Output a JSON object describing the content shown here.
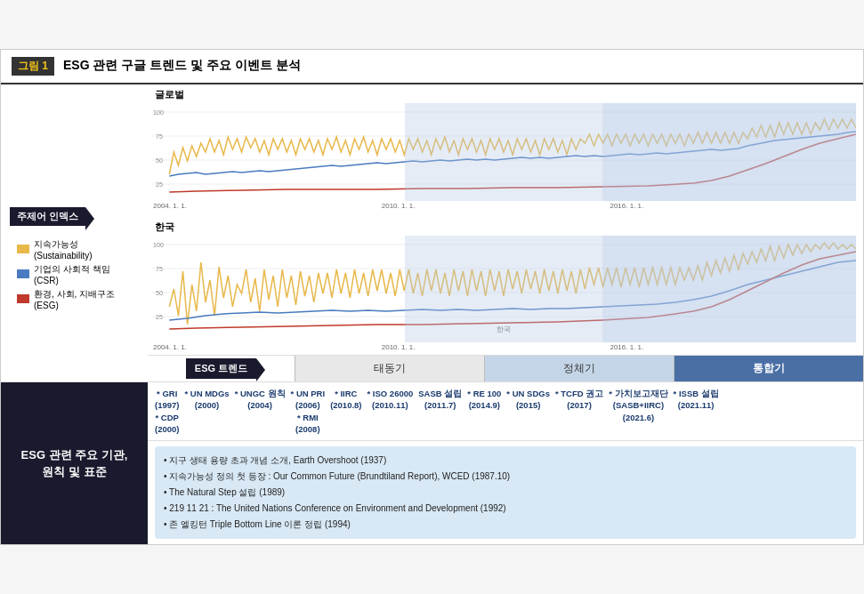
{
  "header": {
    "fig_label": "그림",
    "fig_number": "1",
    "title": "ESG 관련 구글 트렌드 및 주요 이벤트 분석"
  },
  "charts": {
    "global_label": "글로벌",
    "korea_label": "한국",
    "x_labels": [
      "2004. 1. 1.",
      "2010. 1. 1.",
      "2016. 1. 1."
    ],
    "y_labels": [
      "100",
      "75",
      "50",
      "25"
    ]
  },
  "legend": {
    "title": "주제어 인덱스",
    "items": [
      {
        "label": "지속가능성 (Sustainability)",
        "color": "#e8b84b"
      },
      {
        "label": "기업의 사회적 책임 (CSR)",
        "color": "#4a7abf"
      },
      {
        "label": "환경, 사회, 지배구조 (ESG)",
        "color": "#c0392b"
      }
    ]
  },
  "trend_row": {
    "label": "ESG 트렌드",
    "cells": [
      {
        "label": "태동기",
        "class": "taedongi"
      },
      {
        "label": "정체기",
        "class": "jeonhwagi"
      },
      {
        "label": "통합기",
        "class": "donghabgi"
      }
    ]
  },
  "bottom": {
    "left_label": "ESG 관련 주요 기관,\n원칙 및 표준",
    "events": [
      {
        "name": "* GRI\n(1997)",
        "extra": "* CDP\n(2000)"
      },
      {
        "name": "* UN MDGs\n(2000)"
      },
      {
        "name": "* UNGC 원칙\n(2004)"
      },
      {
        "name": "* UN PRI\n(2006)",
        "extra": "* RMI\n(2008)"
      },
      {
        "name": "* IIRC\n(2010.8)"
      },
      {
        "name": "* ISO 26000\n(2010.11)"
      },
      {
        "name": "SASB 설립\n(2011.7)"
      },
      {
        "name": "* RE 100\n(2014.9)"
      },
      {
        "name": "* UN SDGs\n(2015)"
      },
      {
        "name": "* TCFD 권고\n(2017)"
      },
      {
        "name": "* 가치보고재단\n(SASB+IIRC)\n(2021.6)"
      },
      {
        "name": "* ISSB 설립\n(2021.11)"
      }
    ],
    "info_items": [
      "• 지구 생태 용량 초과 개념 소개, Earth Overshoot (1937)",
      "• 지속가능성 정의 첫 등장 : Our Common Future (Brundtiland Report), WCED (1987.10)",
      "• The Natural Step 설립 (1989)",
      "• 219 11 21 : The United Nations Conference on Environment and Development (1992)",
      "• 존 엘킹턴 Triple Bottom Line 이론 정립 (1994)"
    ]
  }
}
